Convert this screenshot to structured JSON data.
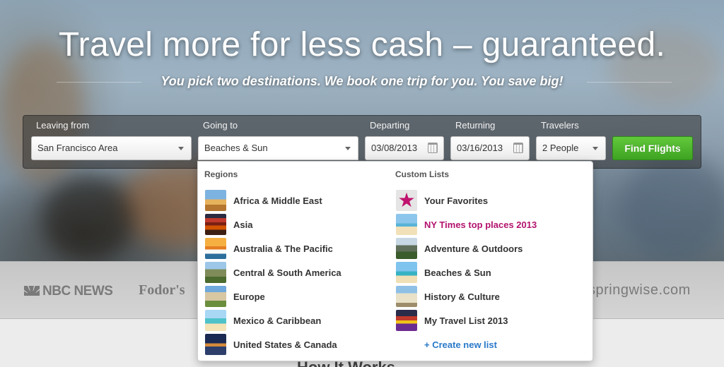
{
  "hero": {
    "title": "Travel more for less cash – guaranteed.",
    "subtitle": "You pick two destinations. We book one trip for you. You save big!"
  },
  "search": {
    "leaving_label": "Leaving from",
    "leaving_value": "San Francisco Area",
    "going_label": "Going to",
    "going_value": "Beaches & Sun",
    "departing_label": "Departing",
    "departing_value": "03/08/2013",
    "returning_label": "Returning",
    "returning_value": "03/16/2013",
    "travelers_label": "Travelers",
    "travelers_value": "2 People",
    "find_button": "Find Flights"
  },
  "dropdown": {
    "regions_heading": "Regions",
    "regions": [
      {
        "label": "Africa & Middle East",
        "icon": "africa-thumbnail"
      },
      {
        "label": "Asia",
        "icon": "asia-thumbnail"
      },
      {
        "label": "Australia & The Pacific",
        "icon": "australia-thumbnail"
      },
      {
        "label": "Central & South America",
        "icon": "central-america-thumbnail"
      },
      {
        "label": "Europe",
        "icon": "europe-thumbnail"
      },
      {
        "label": "Mexico & Caribbean",
        "icon": "mexico-thumbnail"
      },
      {
        "label": "United States & Canada",
        "icon": "usa-thumbnail"
      }
    ],
    "lists_heading": "Custom Lists",
    "lists": [
      {
        "label": "Your Favorites",
        "icon": "star-icon"
      },
      {
        "label": "NY Times top places 2013",
        "icon": "nyt-thumbnail",
        "highlight_color": "#b3126e"
      },
      {
        "label": "Adventure & Outdoors",
        "icon": "adventure-thumbnail"
      },
      {
        "label": "Beaches & Sun",
        "icon": "beach-thumbnail"
      },
      {
        "label": "History & Culture",
        "icon": "history-thumbnail"
      },
      {
        "label": "My Travel List 2013",
        "icon": "my-list-thumbnail"
      }
    ],
    "star_glyph": "★",
    "new_list": "+ Create new list"
  },
  "press": {
    "nbc": "NBC NEWS",
    "fodors": "Fodor's",
    "springwise": "springwise.com"
  },
  "below": {
    "how_it_works": "How It Works"
  },
  "colors": {
    "accent_green": "#4cb52b",
    "highlight_magenta": "#b3126e",
    "link_blue": "#2a79c9"
  }
}
